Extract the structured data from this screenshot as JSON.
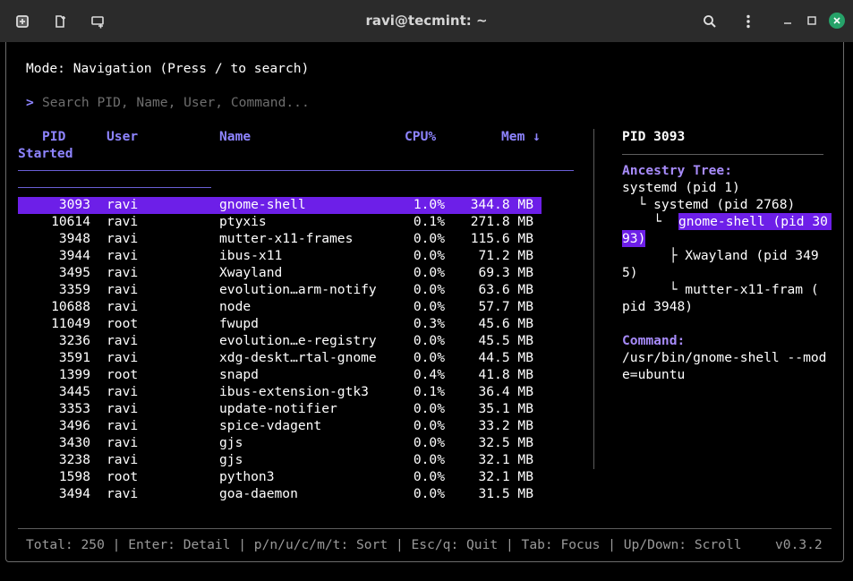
{
  "window": {
    "title": "ravi@tecmint: ~"
  },
  "icons": {
    "new_tab": "new-tab-icon",
    "split": "split-terminal-icon",
    "tab_overview": "tab-overview-icon",
    "search": "search-icon",
    "menu": "kebab-menu-icon",
    "minimize": "minimize-icon",
    "maximize": "maximize-icon",
    "close": "close-icon"
  },
  "colors": {
    "accent": "#8e84ff",
    "selection": "#6d1fe8",
    "close_button": "#26a269"
  },
  "mode_line": "Mode: Navigation (Press / to search)",
  "search": {
    "prompt": ">",
    "placeholder": "Search PID, Name, User, Command..."
  },
  "table": {
    "headers": {
      "pid": "PID",
      "user": "User",
      "name": "Name",
      "cpu": "CPU%",
      "mem": "Mem ↓",
      "started": "Started"
    },
    "rows": [
      {
        "pid": "3093",
        "user": "ravi",
        "name": "gnome-shell",
        "cpu": "1.0%",
        "mem": "344.8 MB"
      },
      {
        "pid": "10614",
        "user": "ravi",
        "name": "ptyxis",
        "cpu": "0.1%",
        "mem": "271.8 MB"
      },
      {
        "pid": "3948",
        "user": "ravi",
        "name": "mutter-x11-frames",
        "cpu": "0.0%",
        "mem": "115.6 MB"
      },
      {
        "pid": "3944",
        "user": "ravi",
        "name": "ibus-x11",
        "cpu": "0.0%",
        "mem": "71.2 MB"
      },
      {
        "pid": "3495",
        "user": "ravi",
        "name": "Xwayland",
        "cpu": "0.0%",
        "mem": "69.3 MB"
      },
      {
        "pid": "3359",
        "user": "ravi",
        "name": "evolution…arm-notify",
        "cpu": "0.0%",
        "mem": "63.6 MB"
      },
      {
        "pid": "10688",
        "user": "ravi",
        "name": "node",
        "cpu": "0.0%",
        "mem": "57.7 MB"
      },
      {
        "pid": "11049",
        "user": "root",
        "name": "fwupd",
        "cpu": "0.3%",
        "mem": "45.6 MB"
      },
      {
        "pid": "3236",
        "user": "ravi",
        "name": "evolution…e-registry",
        "cpu": "0.0%",
        "mem": "45.5 MB"
      },
      {
        "pid": "3591",
        "user": "ravi",
        "name": "xdg-deskt…rtal-gnome",
        "cpu": "0.0%",
        "mem": "44.5 MB"
      },
      {
        "pid": "1399",
        "user": "root",
        "name": "snapd",
        "cpu": "0.4%",
        "mem": "41.8 MB"
      },
      {
        "pid": "3445",
        "user": "ravi",
        "name": "ibus-extension-gtk3",
        "cpu": "0.1%",
        "mem": "36.4 MB"
      },
      {
        "pid": "3353",
        "user": "ravi",
        "name": "update-notifier",
        "cpu": "0.0%",
        "mem": "35.1 MB"
      },
      {
        "pid": "3496",
        "user": "ravi",
        "name": "spice-vdagent",
        "cpu": "0.0%",
        "mem": "33.2 MB"
      },
      {
        "pid": "3430",
        "user": "ravi",
        "name": "gjs",
        "cpu": "0.0%",
        "mem": "32.5 MB"
      },
      {
        "pid": "3238",
        "user": "ravi",
        "name": "gjs",
        "cpu": "0.0%",
        "mem": "32.1 MB"
      },
      {
        "pid": "1598",
        "user": "root",
        "name": "python3",
        "cpu": "0.0%",
        "mem": "32.1 MB"
      },
      {
        "pid": "3494",
        "user": "ravi",
        "name": "goa-daemon",
        "cpu": "0.0%",
        "mem": "31.5 MB"
      }
    ]
  },
  "detail": {
    "title": "PID 3093",
    "ancestry_label": "Ancestry Tree:",
    "tree_lines": [
      "systemd (pid 1)",
      "  └ systemd (pid 2768)",
      "    └ ",
      "gnome-shell (pid 30",
      "93)",
      "      ├ Xwayland (pid 349",
      "5)",
      "      └ mutter-x11-fram (",
      "pid 3948)"
    ],
    "command_label": "Command:",
    "command_lines": [
      "/usr/bin/gnome-shell --mod",
      "e=ubuntu"
    ]
  },
  "footer": {
    "status": "Total: 250 | Enter: Detail | p/n/u/c/m/t: Sort | Esc/q: Quit | Tab: Focus | Up/Down: Scroll",
    "version": "v0.3.2"
  }
}
